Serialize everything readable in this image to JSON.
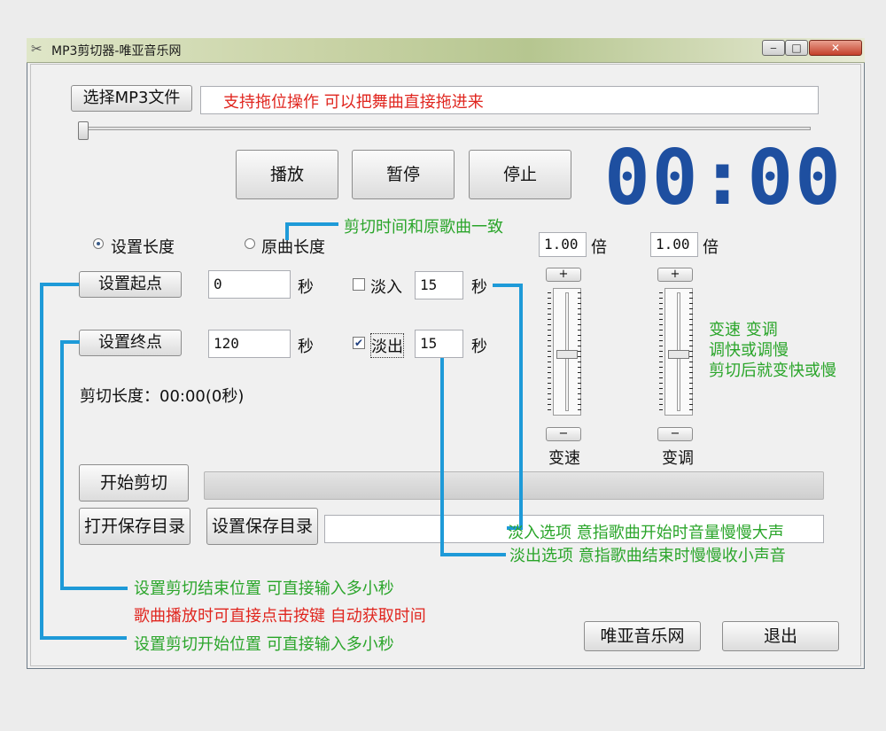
{
  "window": {
    "title": "MP3剪切器-唯亚音乐网",
    "minimize": "‒",
    "maximize": "□",
    "close": "✕"
  },
  "file": {
    "choose_label": "选择MP3文件",
    "drop_hint": "支持拖位操作   可以把舞曲直接拖进来"
  },
  "position_slider": {
    "value": 0
  },
  "controls": {
    "play": "播放",
    "pause": "暂停",
    "stop": "停止"
  },
  "timer": "00:00",
  "mode": {
    "set_length": "设置长度",
    "original_length": "原曲长度",
    "selected": "set_length"
  },
  "start": {
    "button": "设置起点",
    "value": "0",
    "unit": "秒"
  },
  "end": {
    "button": "设置终点",
    "value": "120",
    "unit": "秒"
  },
  "fade_in": {
    "label": "淡入",
    "checked": false,
    "value": "15",
    "unit": "秒"
  },
  "fade_out": {
    "label": "淡出",
    "checked": true,
    "value": "15",
    "unit": "秒"
  },
  "cut_length": "剪切长度：00:00(0秒)",
  "speed": {
    "value": "1.00",
    "unit": "倍",
    "plus": "+",
    "minus": "−",
    "label": "变速"
  },
  "pitch": {
    "value": "1.00",
    "unit": "倍",
    "plus": "+",
    "minus": "−",
    "label": "变调"
  },
  "actions": {
    "start_cut": "开始剪切",
    "open_save_dir": "打开保存目录",
    "set_save_dir": "设置保存目录",
    "website": "唯亚音乐网",
    "exit": "退出"
  },
  "annotations": {
    "original_length_note": "剪切时间和原歌曲一致",
    "speed_note_1": "变速  变调",
    "speed_note_2": "调快或调慢",
    "speed_note_3": "剪切后就变快或慢",
    "fade_in_note": "淡入选项    意指歌曲开始时音量慢慢大声",
    "fade_out_note": "淡出选项    意指歌曲结束时慢慢收小声音",
    "end_note": "设置剪切结束位置    可直接输入多小秒",
    "play_note": "歌曲播放时可直接点击按键   自动获取时间",
    "start_note": "设置剪切开始位置    可直接输入多小秒"
  },
  "colors": {
    "annotation_green": "#2aa52a",
    "annotation_red": "#e0261f",
    "leader_blue": "#1e9ad8",
    "timer_blue": "#1e4fa0"
  }
}
